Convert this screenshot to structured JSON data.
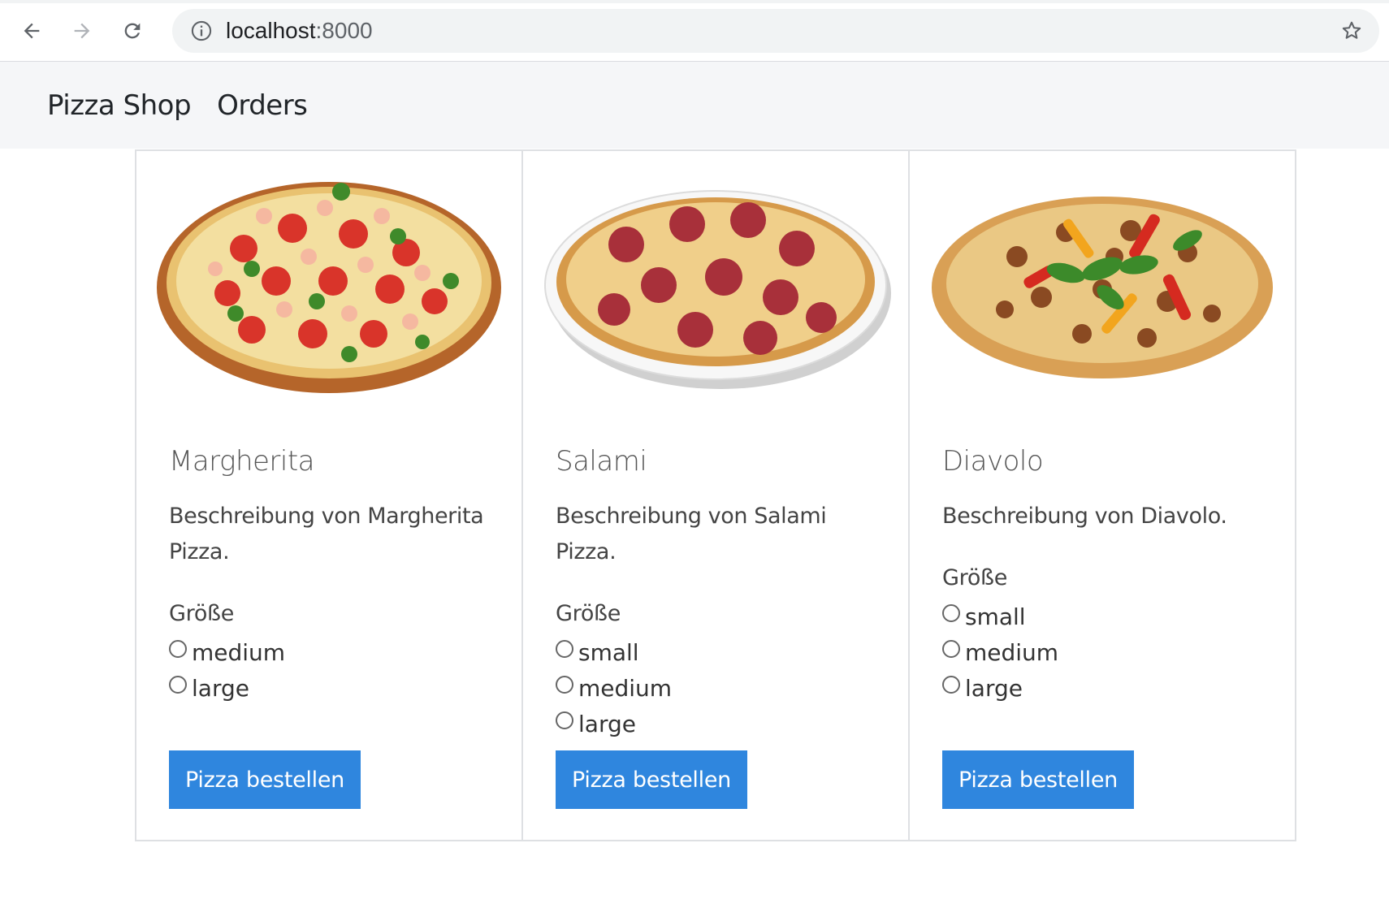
{
  "browser": {
    "url_host": "localhost",
    "url_port": ":8000"
  },
  "navbar": {
    "brand": "Pizza Shop",
    "orders_link": "Orders"
  },
  "size_label": "Größe",
  "order_button_label": "Pizza bestellen",
  "colors": {
    "button": "#2f86de",
    "navbar_bg": "#f5f6f8",
    "card_border": "#dee0e3"
  },
  "pizzas": [
    {
      "name": "Margherita",
      "description": "Beschreibung von Margherita Pizza.",
      "sizes": [
        "medium",
        "large"
      ]
    },
    {
      "name": "Salami",
      "description": "Beschreibung von Salami Pizza.",
      "sizes": [
        "small",
        "medium",
        "large"
      ]
    },
    {
      "name": "Diavolo",
      "description": "Beschreibung von Diavolo.",
      "sizes": [
        "small",
        "medium",
        "large"
      ]
    }
  ]
}
